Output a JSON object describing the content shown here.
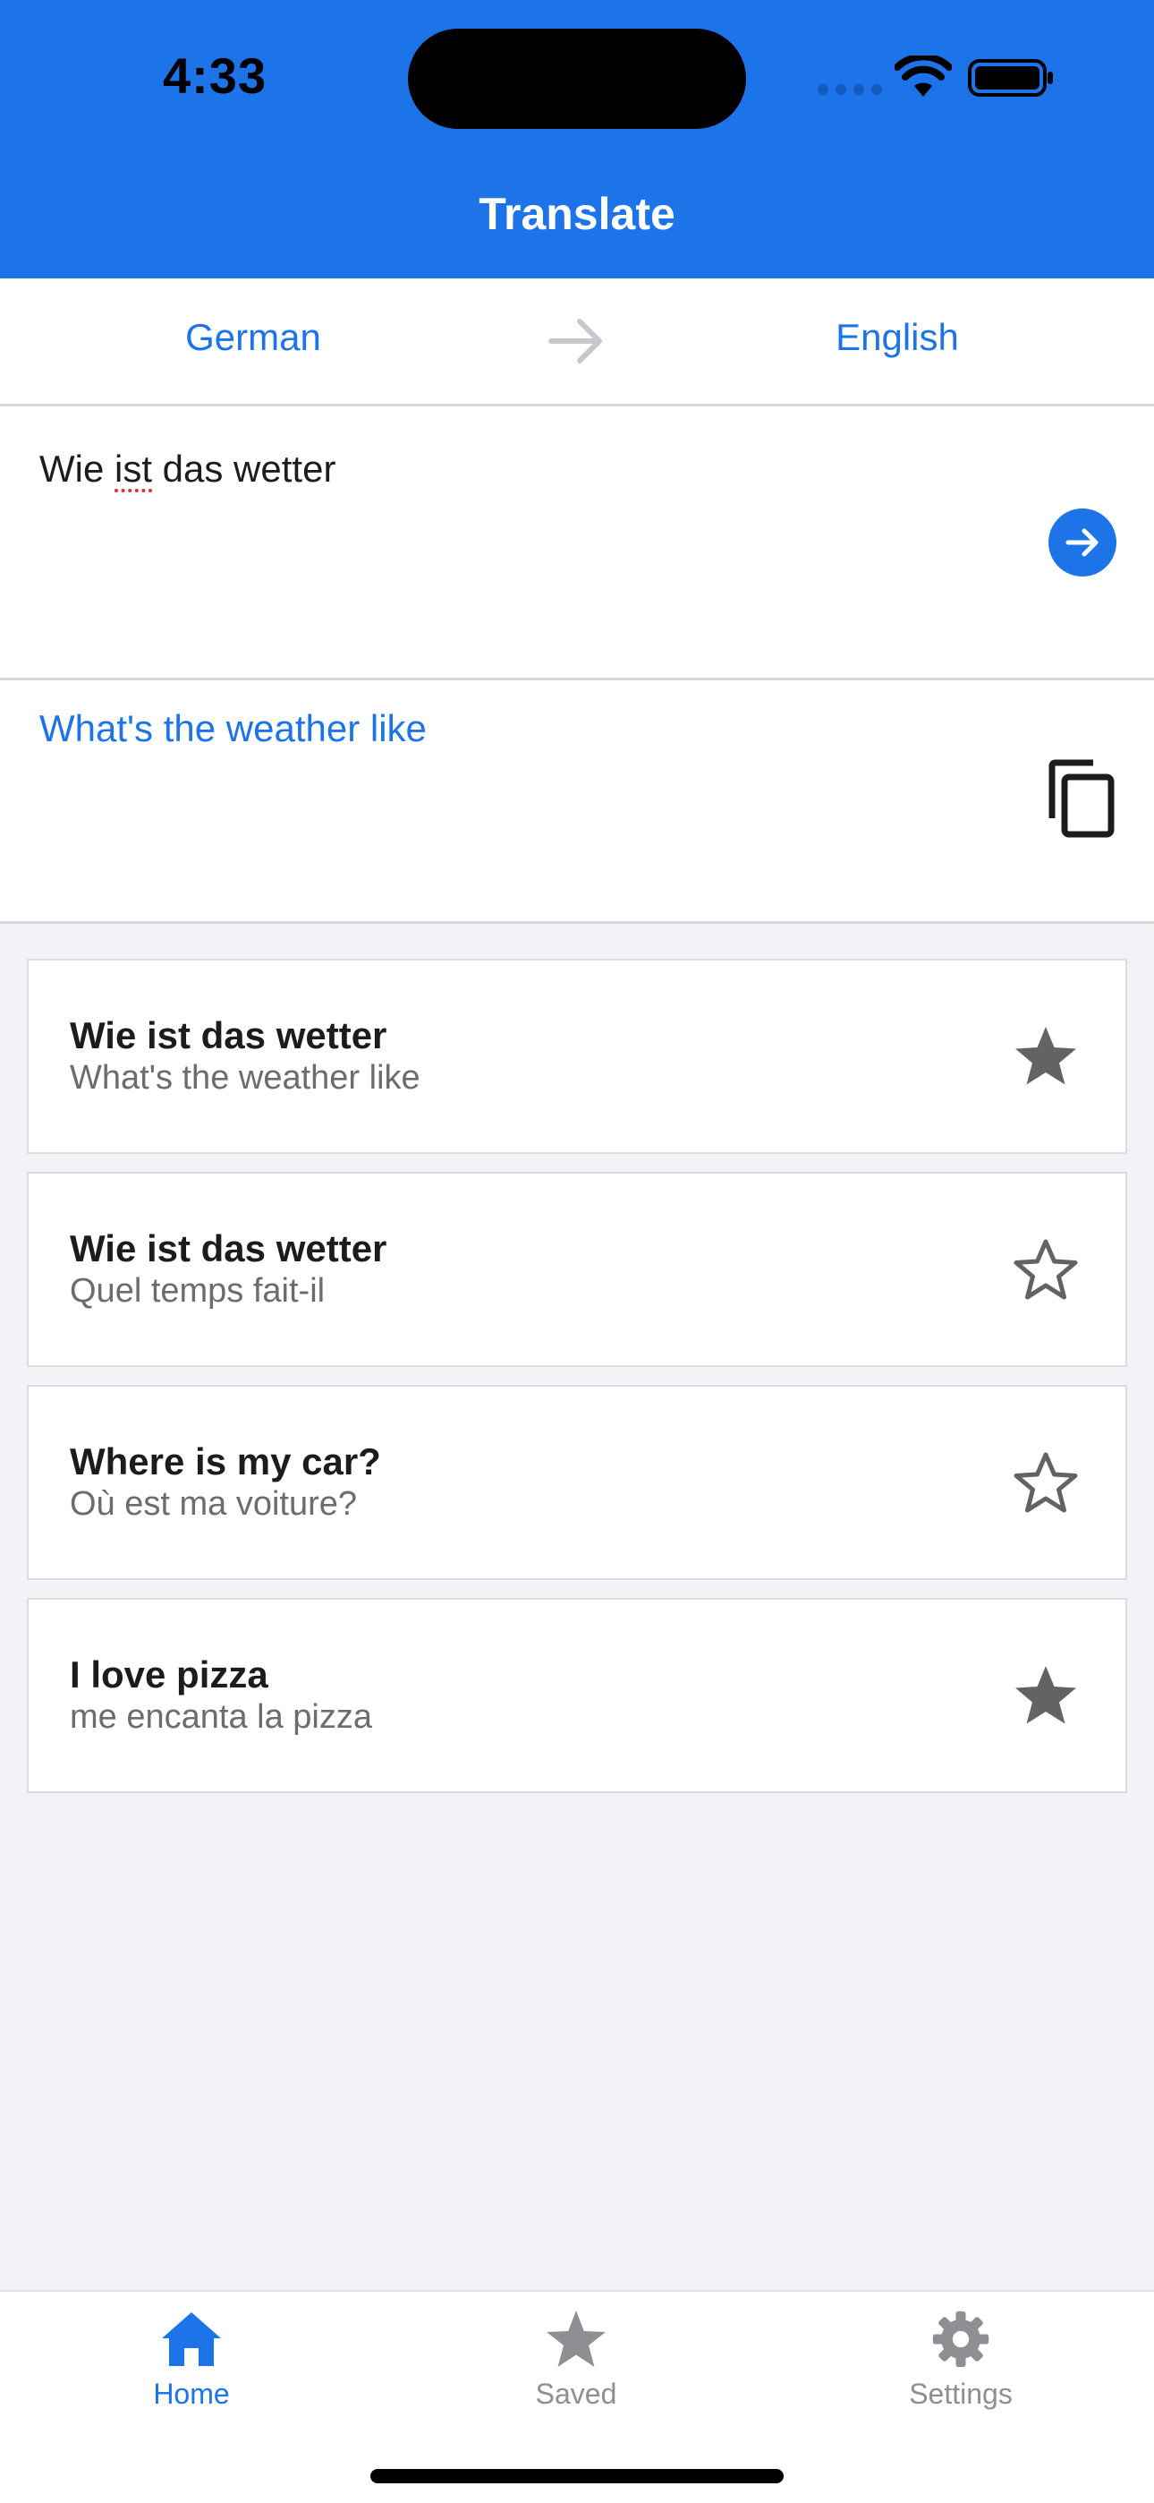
{
  "status_bar": {
    "time": "4:33"
  },
  "header": {
    "title": "Translate"
  },
  "languages": {
    "source": "German",
    "target": "English"
  },
  "input": {
    "text_before": "Wie ",
    "text_misspelled": "ist",
    "text_after": " das wetter"
  },
  "output": {
    "text": "What's the weather like"
  },
  "history": [
    {
      "original": "Wie ist das wetter",
      "translation": "What's the weather like",
      "starred": true
    },
    {
      "original": "Wie ist das wetter",
      "translation": "Quel temps fait-il",
      "starred": false
    },
    {
      "original": "Where is my car?",
      "translation": "Où est ma voiture?",
      "starred": false
    },
    {
      "original": "I love pizza",
      "translation": "me encanta la pizza",
      "starred": true
    }
  ],
  "tabs": [
    {
      "label": "Home",
      "icon": "home-icon",
      "active": true
    },
    {
      "label": "Saved",
      "icon": "star-icon",
      "active": false
    },
    {
      "label": "Settings",
      "icon": "gear-icon",
      "active": false
    }
  ],
  "colors": {
    "accent": "#1c74e8",
    "star": "#636366",
    "inactive": "#8e8e93"
  }
}
